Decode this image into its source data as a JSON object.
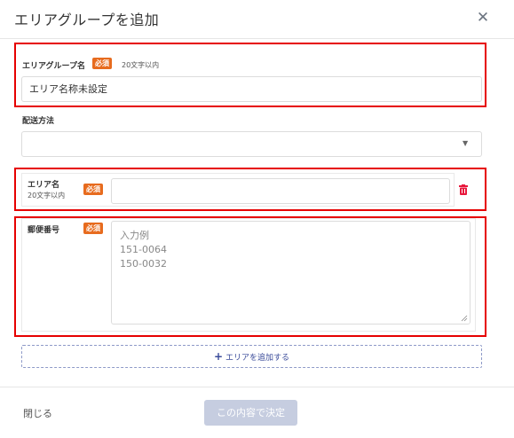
{
  "header": {
    "title": "エリアグループを追加"
  },
  "group_name": {
    "label": "エリアグループ名",
    "required_badge": "必須",
    "hint": "20文字以内",
    "value": "エリア名称未設定"
  },
  "delivery_method": {
    "label": "配送方法",
    "value": ""
  },
  "area_name": {
    "label": "エリア名",
    "hint": "20文字以内",
    "required_badge": "必須",
    "value": ""
  },
  "postal_code": {
    "label": "郵便番号",
    "required_badge": "必須",
    "placeholder_lines": [
      "入力例",
      "151-0064",
      "150-0032"
    ]
  },
  "add_area_button": {
    "plus": "+",
    "label": "エリアを追加する"
  },
  "footer": {
    "close_label": "閉じる",
    "submit_label": "この内容で決定"
  },
  "colors": {
    "required_badge": "#e76b1e",
    "highlight_border": "#e60000",
    "trash": "#e8173c",
    "submit_disabled": "#c6cde0"
  },
  "icons": {
    "close": "close-icon",
    "trash": "trash-icon",
    "dropdown": "chevron-down-icon"
  }
}
